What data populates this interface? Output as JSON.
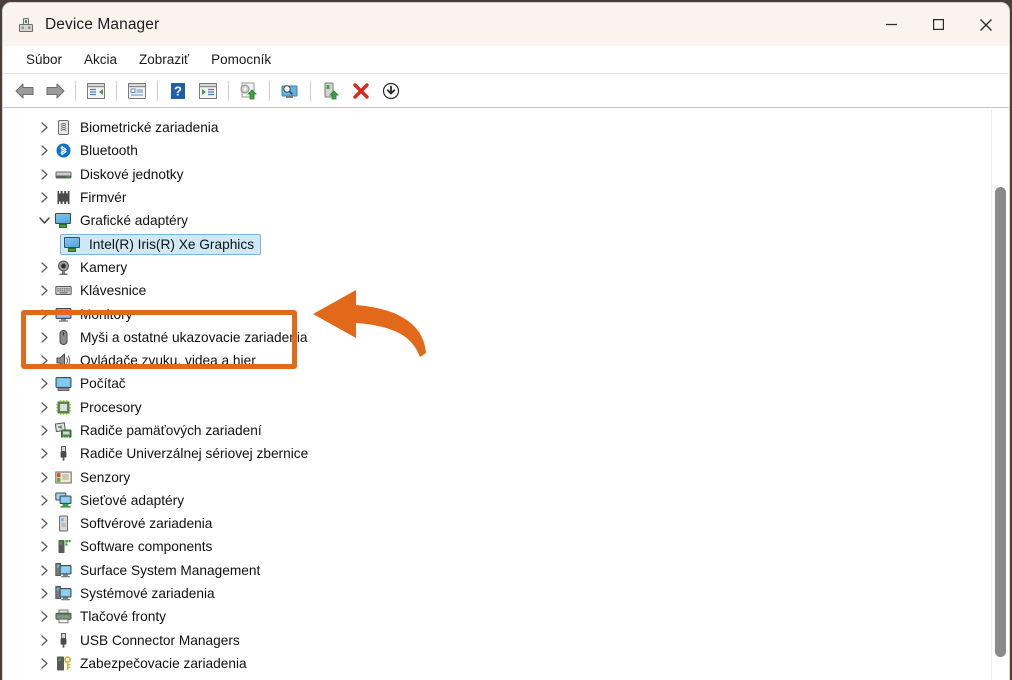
{
  "window": {
    "title": "Device Manager",
    "app_icon": "device-manager-icon",
    "controls": {
      "minimize": "─",
      "maximize": "☐",
      "close": "✕"
    }
  },
  "menubar": {
    "items": [
      {
        "label": "Súbor",
        "name": "menu-subor"
      },
      {
        "label": "Akcia",
        "name": "menu-akcia"
      },
      {
        "label": "Zobraziť",
        "name": "menu-zobrazit"
      },
      {
        "label": "Pomocník",
        "name": "menu-pomocnik"
      }
    ]
  },
  "toolbar": {
    "buttons": [
      {
        "name": "back-arrow-icon",
        "tip": "Back"
      },
      {
        "name": "forward-arrow-icon",
        "tip": "Forward"
      },
      {
        "name": "show-hide-console-tree-icon",
        "tip": "Show/Hide console tree"
      },
      {
        "name": "properties-icon",
        "tip": "Properties"
      },
      {
        "name": "help-icon",
        "tip": "Help"
      },
      {
        "name": "show-hide-action-pane-icon",
        "tip": "Show/Hide action pane"
      },
      {
        "name": "update-driver-icon",
        "tip": "Update driver"
      },
      {
        "name": "scan-for-hardware-changes-icon",
        "tip": "Scan for hardware changes"
      },
      {
        "name": "enable-device-icon",
        "tip": "Enable device"
      },
      {
        "name": "uninstall-device-icon",
        "tip": "Uninstall device"
      },
      {
        "name": "disable-device-icon",
        "tip": "Disable device"
      }
    ]
  },
  "tree": {
    "items": [
      {
        "label": "Biometrické zariadenia",
        "icon": "fingerprint-icon",
        "expanded": false,
        "level": 0
      },
      {
        "label": "Bluetooth",
        "icon": "bluetooth-icon",
        "expanded": false,
        "level": 0
      },
      {
        "label": "Diskové jednotky",
        "icon": "disk-drive-icon",
        "expanded": false,
        "level": 0
      },
      {
        "label": "Firmvér",
        "icon": "firmware-chip-icon",
        "expanded": false,
        "level": 0
      },
      {
        "label": "Grafické adaptéry",
        "icon": "display-adapter-icon",
        "expanded": true,
        "level": 0,
        "highlighted": true
      },
      {
        "label": "Intel(R) Iris(R) Xe Graphics",
        "icon": "display-adapter-icon",
        "expanded": null,
        "level": 1,
        "selected": true
      },
      {
        "label": "Kamery",
        "icon": "camera-icon",
        "expanded": false,
        "level": 0
      },
      {
        "label": "Klávesnice",
        "icon": "keyboard-icon",
        "expanded": false,
        "level": 0
      },
      {
        "label": "Monitory",
        "icon": "monitor-icon",
        "expanded": false,
        "level": 0
      },
      {
        "label": "Myši a ostatné ukazovacie zariadenia",
        "icon": "mouse-icon",
        "expanded": false,
        "level": 0
      },
      {
        "label": "Ovládače zvuku, videa a hier",
        "icon": "speaker-icon",
        "expanded": false,
        "level": 0
      },
      {
        "label": "Počítač",
        "icon": "computer-icon",
        "expanded": false,
        "level": 0
      },
      {
        "label": "Procesory",
        "icon": "processor-icon",
        "expanded": false,
        "level": 0
      },
      {
        "label": "Radiče pamäťových zariadení",
        "icon": "storage-controller-icon",
        "expanded": false,
        "level": 0
      },
      {
        "label": "Radiče Univerzálnej sériovej zbernice",
        "icon": "usb-controller-icon",
        "expanded": false,
        "level": 0
      },
      {
        "label": "Senzory",
        "icon": "sensor-icon",
        "expanded": false,
        "level": 0
      },
      {
        "label": "Sieťové adaptéry",
        "icon": "network-adapter-icon",
        "expanded": false,
        "level": 0
      },
      {
        "label": "Softvérové zariadenia",
        "icon": "software-device-icon",
        "expanded": false,
        "level": 0
      },
      {
        "label": "Software components",
        "icon": "software-component-icon",
        "expanded": false,
        "level": 0
      },
      {
        "label": "Surface System Management",
        "icon": "system-device-icon",
        "expanded": false,
        "level": 0
      },
      {
        "label": "Systémové zariadenia",
        "icon": "system-device-icon",
        "expanded": false,
        "level": 0
      },
      {
        "label": "Tlačové fronty",
        "icon": "printer-icon",
        "expanded": false,
        "level": 0
      },
      {
        "label": "USB Connector Managers",
        "icon": "usb-controller-icon",
        "expanded": false,
        "level": 0
      },
      {
        "label": "Zabezpečovacie zariadenia",
        "icon": "security-device-icon",
        "expanded": false,
        "level": 0
      }
    ],
    "chevron_collapsed": "›",
    "chevron_expanded": "⌄"
  },
  "annotation": {
    "highlight_color": "#E2681A",
    "arrow": "left-pointing-curved-arrow",
    "target": "Grafické adaptéry"
  },
  "colors": {
    "titlebar_bg": "#FAF3EE",
    "selection_bg": "#CDE8F7",
    "selection_border": "#7CB7DA",
    "annotation_orange": "#E2681A",
    "scrollbar_thumb": "#8A8A8A"
  }
}
